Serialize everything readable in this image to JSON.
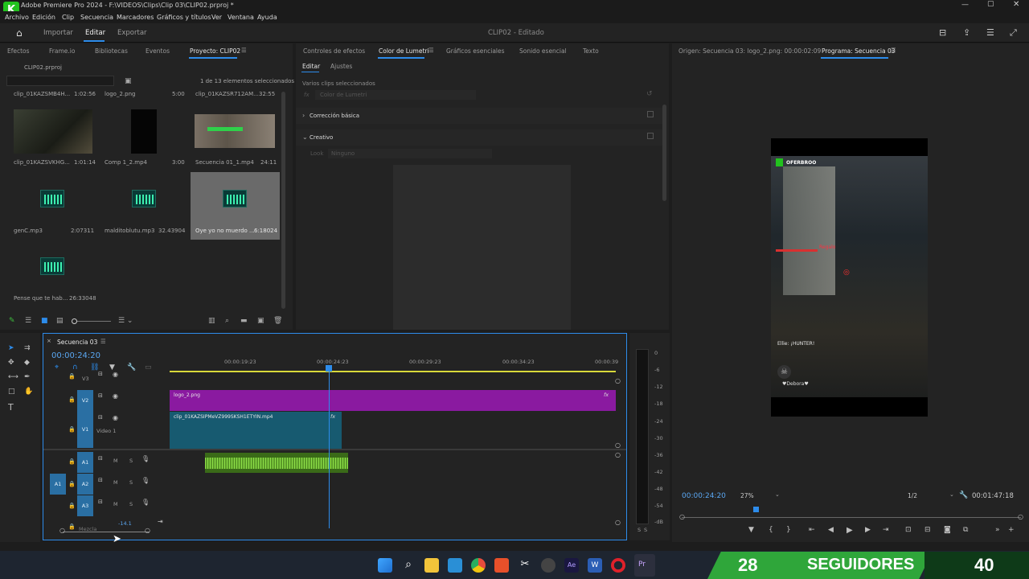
{
  "window": {
    "title": "Adobe Premiere Pro 2024 - F:\\VIDEOS\\Clips\\Clip 03\\CLIP02.prproj *"
  },
  "menu": [
    "Archivo",
    "Edición",
    "Clip",
    "Secuencia",
    "Marcadores",
    "Gráficos y títulos",
    "Ver",
    "Ventana",
    "Ayuda"
  ],
  "header": {
    "tabs": [
      "Importar",
      "Editar",
      "Exportar"
    ],
    "project_title": "CLIP02 - Editado"
  },
  "project_panel": {
    "tabs": [
      "Efectos",
      "Frame.io",
      "Bibliotecas",
      "Eventos",
      "Proyecto: CLIP02"
    ],
    "file": "CLIP02.prproj",
    "selection_info": "1 de 13 elementos seleccionados",
    "items": [
      {
        "name": "clip_01KAZSMB4H...",
        "dur": "1:02:56"
      },
      {
        "name": "logo_2.png",
        "dur": "5:00"
      },
      {
        "name": "clip_01KAZSR712AM...",
        "dur": "32:55"
      },
      {
        "name": "clip_01KAZSVKHG...",
        "dur": "1:01:14"
      },
      {
        "name": "Comp 1_2.mp4",
        "dur": "3:00"
      },
      {
        "name": "Secuencia 01_1.mp4",
        "dur": "24:11"
      },
      {
        "name": "genC.mp3",
        "dur": "2:07311"
      },
      {
        "name": "malditoblutu.mp3",
        "dur": "32.43904"
      },
      {
        "name": "Oye yo no muerdo ...",
        "dur": "6:18024"
      },
      {
        "name": "Pense que te hab...",
        "dur": "26:33048"
      }
    ]
  },
  "lumetri_panel": {
    "tabs": [
      "Controles de efectos",
      "Color de Lumetri",
      "Gráficos esenciales",
      "Sonido esencial",
      "Texto"
    ],
    "subtabs": [
      "Editar",
      "Ajustes"
    ],
    "selection": "Varios clips seleccionados",
    "fx_placeholder": "Color de Lumetri",
    "sections": [
      "Corrección básica",
      "Creativo"
    ],
    "look_label": "Look",
    "look_value": "Ninguno"
  },
  "program_monitor": {
    "source_label": "Origen: Secuencia 03: logo_2.png: 00:00:02:09",
    "program_label": "Programa: Secuencia 03",
    "timecode": "00:00:24:20",
    "zoom": "27%",
    "resolution": "1/2",
    "duration": "00:01:47:18",
    "overlay": {
      "channel": "OFERBROO",
      "chat": "Ellie: ¡HUNTER!",
      "player": "♥Debora♥",
      "tag": "Regalo"
    }
  },
  "timeline": {
    "sequence_tab": "Secuencia 03",
    "timecode": "00:00:24:20",
    "ruler": [
      "00:00:19:23",
      "00:00:24:23",
      "00:00:29:23",
      "00:00:34:23",
      "00:00:39"
    ],
    "tracks_video": [
      {
        "id": "V3",
        "name": ""
      },
      {
        "id": "V2",
        "name": ""
      },
      {
        "id": "V1",
        "name": "Video 1"
      }
    ],
    "tracks_audio": [
      {
        "id": "A1"
      },
      {
        "id": "A2"
      },
      {
        "id": "A3"
      }
    ],
    "mute_label": "M",
    "solo_label": "S",
    "source_patch": "A1",
    "mix_label": "Mezcla",
    "mix_value": "-14.1",
    "clips": {
      "v2": "logo_2.png",
      "v1": "clip_01KAZSIPMeVZ999SKSH1ETYIN.mp4"
    },
    "meter_ticks": [
      "0",
      "-6",
      "-12",
      "-18",
      "-24",
      "-30",
      "-36",
      "-42",
      "-48",
      "-54",
      "-dB"
    ],
    "meter_solo": [
      "S",
      "S"
    ]
  },
  "overlay_counter": {
    "count": "28",
    "label": "SEGUIDORES",
    "goal": "40"
  }
}
